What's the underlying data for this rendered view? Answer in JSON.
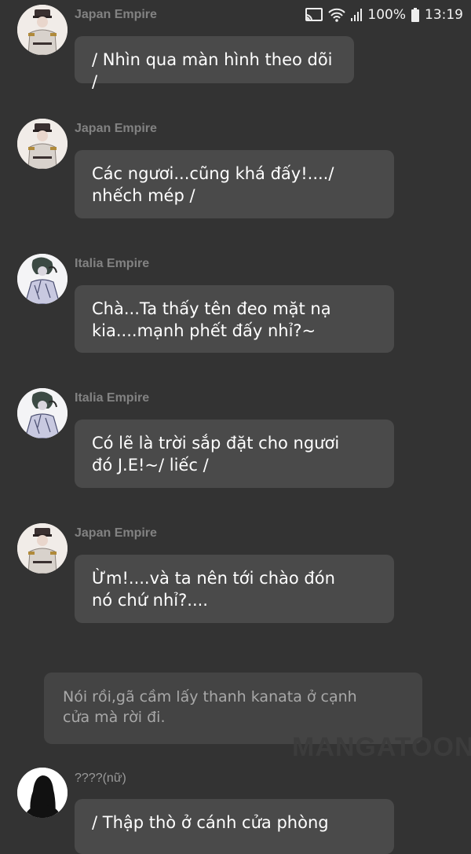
{
  "status_bar": {
    "battery": "100%",
    "time": "13:19",
    "icons": [
      "cast-icon",
      "wifi-icon",
      "signal-icon",
      "battery-icon"
    ]
  },
  "messages": [
    {
      "sender": "Japan Empire",
      "avatar": "japan-empire-avatar",
      "text": "/ Nhìn qua màn hình theo dõi /"
    },
    {
      "sender": "Japan Empire",
      "avatar": "japan-empire-avatar",
      "text": "Các ngươi...cũng khá đấy!..../\nnhếch mép /"
    },
    {
      "sender": "Italia Empire",
      "avatar": "italia-empire-avatar",
      "text": "Chà...Ta thấy tên đeo mặt nạ\nkia....mạnh phết đấy nhỉ?~"
    },
    {
      "sender": "Italia Empire",
      "avatar": "italia-empire-avatar",
      "text": "Có lẽ là trời sắp đặt cho ngươi\nđó J.E!~/ liếc /"
    },
    {
      "sender": "Japan Empire",
      "avatar": "japan-empire-avatar",
      "text": "Ừm!....và ta nên tới chào đón\nnó chứ nhỉ?...."
    }
  ],
  "narration": "Nói rồi,gã cầm lấy thanh kanata ở cạnh\ncửa mà rời đi.",
  "last_message": {
    "sender": "????(nữ)",
    "avatar": "silhouette-avatar",
    "text": "/ Thập thò ở cánh cửa phòng"
  },
  "watermark": "MANGATOON"
}
